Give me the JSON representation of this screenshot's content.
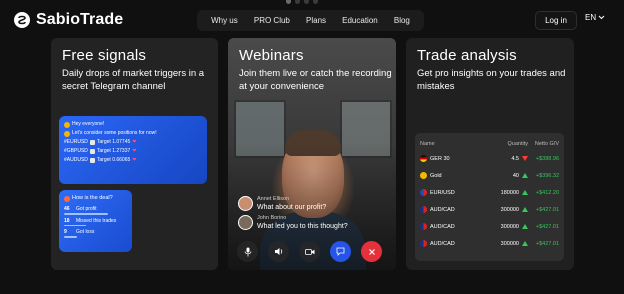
{
  "header": {
    "brand": "SabioTrade",
    "nav": [
      "Why us",
      "PRO Club",
      "Plans",
      "Education",
      "Blog"
    ],
    "login": "Log in",
    "lang": "EN"
  },
  "cards": {
    "signals": {
      "title": "Free signals",
      "subtitle": "Daily drops of market triggers in a secret Telegram channel",
      "message": {
        "greeting": "Hey everyone!",
        "intro": "Let's consider some positions for now!",
        "rows": [
          {
            "pair": "#EURUSD",
            "target": "Target 1.07745"
          },
          {
            "pair": "#GBPUSD",
            "target": "Target 1.27337"
          },
          {
            "pair": "#AUDUSD",
            "target": "Target 0.66065"
          }
        ]
      },
      "poll": {
        "question": "How is the deal?",
        "options": [
          {
            "count": "46",
            "label": "Got profit",
            "share": 0.7
          },
          {
            "count": "18",
            "label": "Missed this trades",
            "share": 0.35
          },
          {
            "count": "9",
            "label": "Got loss",
            "share": 0.2
          }
        ]
      }
    },
    "webinars": {
      "title": "Webinars",
      "subtitle": "Join them live or catch the recording at your convenience",
      "chat": [
        {
          "name": "Annet Ellison",
          "message": "What about our profit?"
        },
        {
          "name": "John Borino",
          "message": "What led you to this thought?"
        }
      ],
      "controls": [
        "mic-icon",
        "speaker-icon",
        "camera-icon",
        "chat-icon",
        "hangup-icon"
      ]
    },
    "analysis": {
      "title": "Trade analysis",
      "subtitle": "Get pro insights on your trades and mistakes",
      "table": {
        "headers": [
          "Name",
          "Quantity",
          "Netto G/V"
        ],
        "rows": [
          {
            "name": "GER 30",
            "qty": "4.5",
            "dir": "down",
            "pl": "+$388.96"
          },
          {
            "name": "Gold",
            "qty": "40",
            "dir": "up",
            "pl": "+$396.32"
          },
          {
            "name": "EUR/USD",
            "qty": "180000",
            "dir": "up",
            "pl": "+$412.20"
          },
          {
            "name": "AUD/CAD",
            "qty": "300000",
            "dir": "up",
            "pl": "+$427.01"
          },
          {
            "name": "AUD/CAD",
            "qty": "300000",
            "dir": "up",
            "pl": "+$427.01"
          },
          {
            "name": "AUD/CAD",
            "qty": "300000",
            "dir": "up",
            "pl": "+$427.01"
          }
        ]
      }
    }
  },
  "colors": {
    "accent": "#2653e8",
    "positive": "#34c759",
    "negative": "#ff3b30",
    "hangup": "#e5313c"
  }
}
